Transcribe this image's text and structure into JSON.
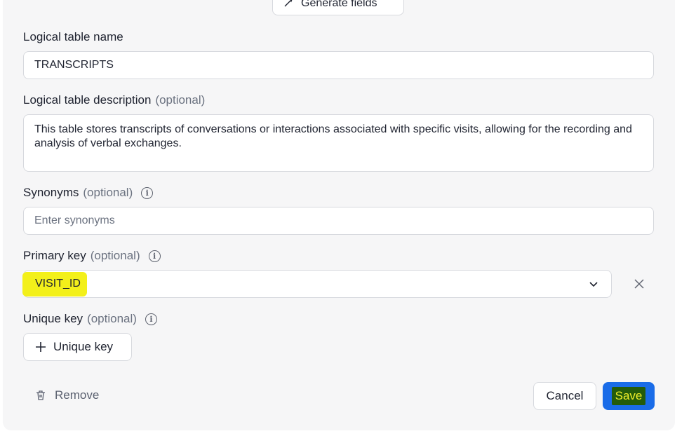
{
  "header": {
    "generate_label": "Generate fields"
  },
  "table_name": {
    "label": "Logical table name",
    "value": "TRANSCRIPTS"
  },
  "description": {
    "label": "Logical table description",
    "optional": "(optional)",
    "value": "This table stores transcripts of conversations or interactions associated with specific visits, allowing for the recording and analysis of verbal exchanges."
  },
  "synonyms": {
    "label": "Synonyms",
    "optional": "(optional)",
    "placeholder": "Enter synonyms"
  },
  "primary_key": {
    "label": "Primary key",
    "optional": "(optional)",
    "value": "VISIT_ID",
    "highlight_color": "#f3f01a"
  },
  "unique_key": {
    "label": "Unique key",
    "optional": "(optional)",
    "button_label": "Unique key"
  },
  "footer": {
    "remove_label": "Remove",
    "cancel_label": "Cancel",
    "save_label": "Save"
  },
  "colors": {
    "save_bg": "#1a6ce8",
    "save_highlight_bg": "#245c0a",
    "save_highlight_text": "#f1ef2a"
  },
  "icons": {
    "generate": "sparkle-wand-icon",
    "info": "info-icon",
    "dropdown": "chevron-down-icon",
    "clear": "close-icon",
    "add": "plus-icon",
    "remove": "trash-icon"
  }
}
